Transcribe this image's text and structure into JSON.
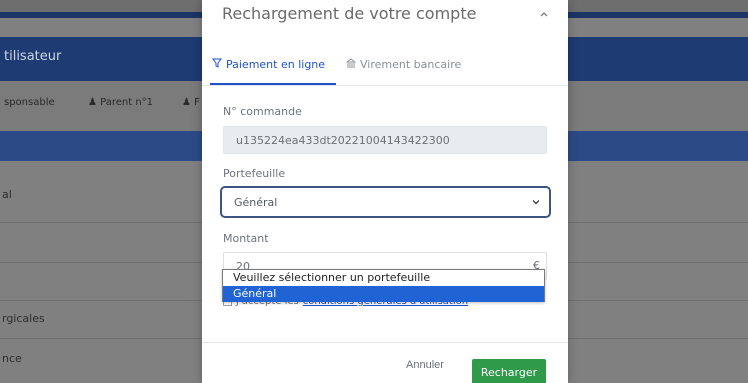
{
  "background": {
    "header_title": "tilisateur",
    "tabs": [
      {
        "label": "sponsable"
      },
      {
        "label": "Parent n°1"
      },
      {
        "label": "F"
      }
    ],
    "rows": [
      "al",
      "",
      "",
      "rgicales",
      "nce"
    ]
  },
  "modal": {
    "title": "Rechargement de votre compte",
    "tabs": [
      {
        "label": "Paiement en ligne",
        "icon": "filter-icon",
        "active": true
      },
      {
        "label": "Virement bancaire",
        "icon": "bank-icon",
        "active": false
      }
    ],
    "order": {
      "label": "N° commande",
      "value": "u135224ea433dt20221004143422300"
    },
    "wallet": {
      "label": "Portefeuille",
      "selected": "Général",
      "options": [
        "Veuillez sélectionner un portefeuille",
        "Général"
      ]
    },
    "amount": {
      "label": "Montant",
      "value": "20",
      "unit": "€"
    },
    "terms": {
      "prefix": "J'accepte les",
      "link": "conditions générales d'utilisation"
    },
    "footer": {
      "cancel": "Annuler",
      "submit": "Recharger"
    }
  },
  "colors": {
    "accent": "#1f52c9",
    "primary_dark": "#1f3b73",
    "success": "#2e9a4a",
    "highlight": "#1f63d4"
  }
}
